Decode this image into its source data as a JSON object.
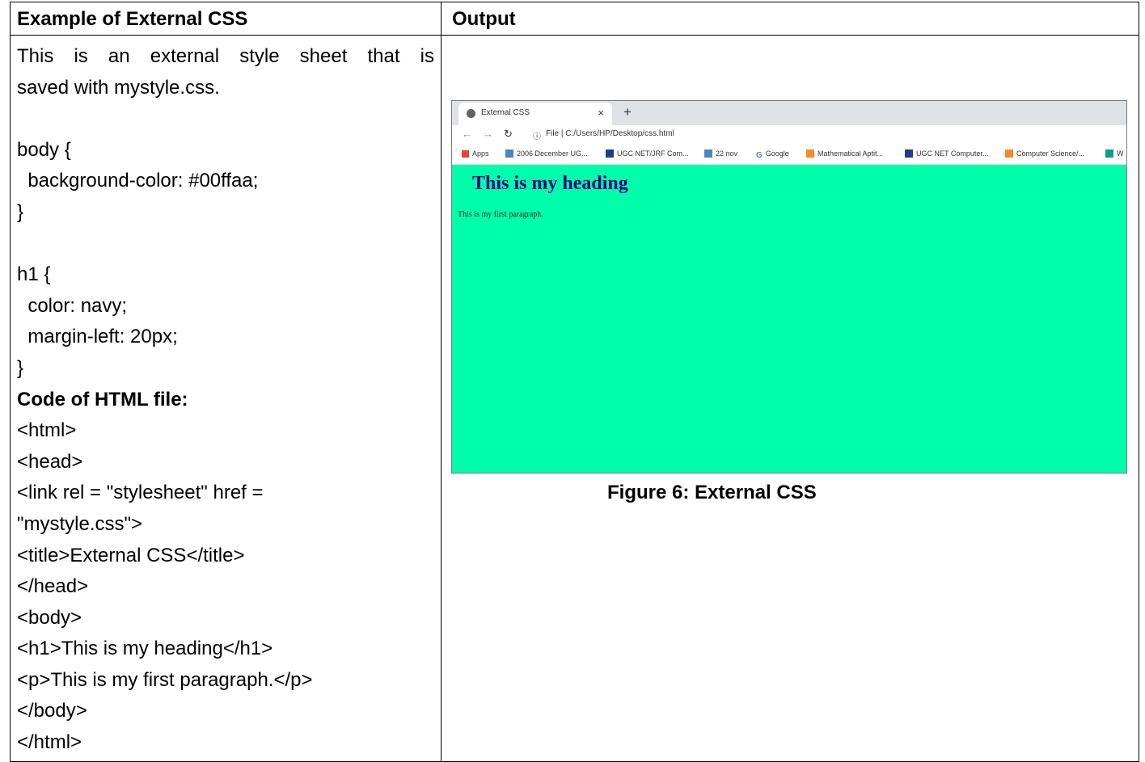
{
  "header": {
    "left": "Example of External CSS",
    "right": "Output"
  },
  "code_lines": [
    "This is an external style sheet that is",
    "saved with mystyle.css.",
    "",
    "body {",
    "  background-color: #00ffaa;",
    "}",
    "",
    "h1 {",
    "  color: navy;",
    "  margin-left: 20px;",
    "}",
    "Code of HTML file:",
    "<html>",
    "<head>",
    "<link rel = \"stylesheet\" href =",
    "\"mystyle.css\">",
    "<title>External CSS</title>",
    "</head>",
    "<body>",
    "<h1>This is my heading</h1>",
    "<p>This is my first paragraph.</p>",
    "</body>",
    "</html>"
  ],
  "browser": {
    "tab_title": "External CSS",
    "tab_close": "×",
    "new_tab": "+",
    "file_label": "File",
    "address": "C:/Users/HP/Desktop/css.html",
    "bookmarks": [
      "Apps",
      "2006 December UG...",
      "UGC NET/JRF Com...",
      "22 nov",
      "Google",
      "Mathematical Aptit...",
      "UGC NET Computer...",
      "Computer Science/...",
      "W"
    ],
    "bookmark_colors": [
      "#e94235",
      "#4a86c6",
      "#1e3e8c",
      "#4a86c6",
      "#4285f4",
      "#f28b25",
      "#1e3e8c",
      "#f28b25",
      "#0f9d8e"
    ],
    "page_background": "#00ffaa",
    "heading": "This is my heading",
    "paragraph": "This is my first paragraph."
  },
  "caption": "Figure 6: External CSS"
}
